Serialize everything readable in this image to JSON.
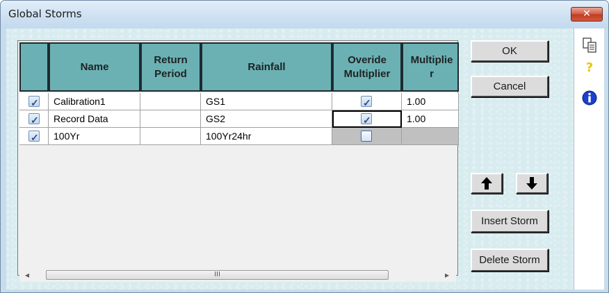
{
  "window": {
    "title": "Global Storms",
    "close_glyph": "✕"
  },
  "table": {
    "columns": [
      "",
      "Name",
      "Return Period",
      "Rainfall",
      "Overide Multiplier",
      "Multiplie r"
    ],
    "rows": [
      {
        "checked": true,
        "name": "Calibration1",
        "return_period": "",
        "rainfall": "GS1",
        "override": true,
        "multiplier": "1.00"
      },
      {
        "checked": true,
        "name": "Record Data",
        "return_period": "",
        "rainfall": "GS2",
        "override": true,
        "multiplier": "1.00"
      },
      {
        "checked": true,
        "name": "100Yr",
        "return_period": "",
        "rainfall": "100Yr24hr",
        "override": false,
        "multiplier": ""
      }
    ],
    "scroll_thumb_label": "III",
    "scroll_left": "◂",
    "scroll_right": "▸"
  },
  "buttons": {
    "ok": "OK",
    "cancel": "Cancel",
    "insert": "Insert Storm",
    "delete": "Delete Storm"
  },
  "side_icons": [
    "copy-icon",
    "help-icon",
    "info-icon"
  ]
}
